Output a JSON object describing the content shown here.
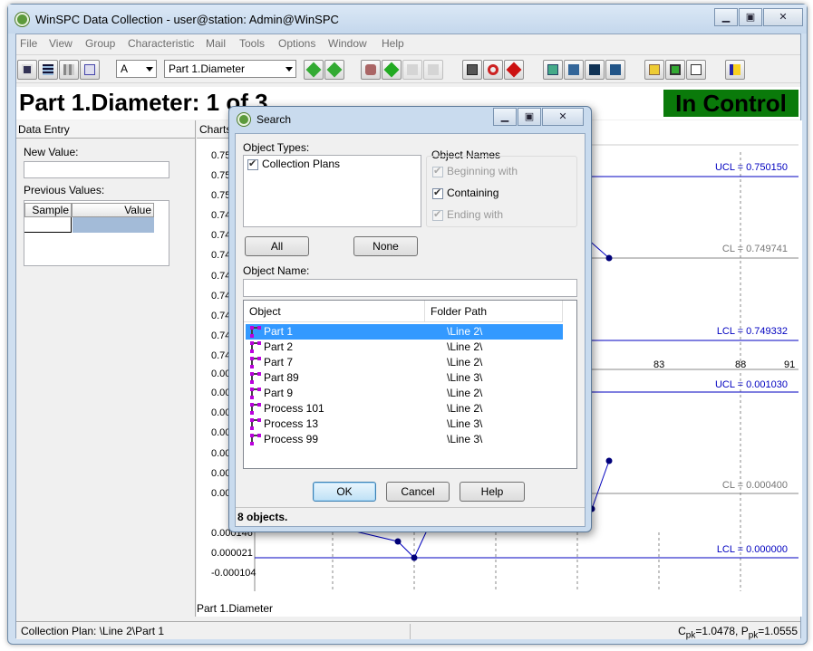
{
  "window": {
    "title": "WinSPC Data Collection - user@station: Admin@WinSPC",
    "minimize": "▁",
    "restore": "▣",
    "close": "✕"
  },
  "menu": [
    "File",
    "View",
    "Group",
    "Characteristic",
    "Mail",
    "Tools",
    "Options",
    "Window",
    "Help"
  ],
  "toolbar": {
    "group_value": "A",
    "characteristic_value": "Part 1.Diameter"
  },
  "header": {
    "title": "Part 1.Diameter:  1 of 3",
    "status": "In Control"
  },
  "data_entry": {
    "header": "Data Entry",
    "new_value_label": "New Value:",
    "previous_values_label": "Previous Values:",
    "col_sample": "Sample",
    "col_value": "Value"
  },
  "charts": {
    "tab_label": "Charts",
    "caption": "Part 1.Diameter",
    "upper_ticks": [
      "0.75",
      "0.75",
      "0.75",
      "0.74",
      "0.74",
      "0.74",
      "0.74",
      "0.74",
      "0.74",
      "0.74",
      "0.74"
    ],
    "lower_ticks": [
      "0.00",
      "0.00",
      "0.00",
      "0.00",
      "0.00",
      "0.00",
      "0.00",
      "0.000146",
      "0.000021",
      "-0.000104"
    ],
    "x_ticks": [
      "83",
      "88",
      "91"
    ],
    "ucl_x": "UCL = 0.750150",
    "cl_x": "CL = 0.749741",
    "lcl_x": "LCL = 0.749332",
    "ucl_r": "UCL = 0.001030",
    "cl_r": "CL = 0.000400",
    "lcl_r": "LCL = 0.000000"
  },
  "statusbar": {
    "left": "Collection Plan: \\Line 2\\Part 1",
    "right_cpk": "C",
    "right_cpk_sub": "pk",
    "right_cpk_val": "=1.0478, P",
    "right_ppk_sub": "pk",
    "right_ppk_val": "=1.0555"
  },
  "search_dialog": {
    "title": "Search",
    "object_types_label": "Object Types:",
    "object_types": [
      {
        "label": "Collection Plans",
        "checked": true
      }
    ],
    "object_names_label": "Object Names",
    "name_options": [
      {
        "label": "Beginning with",
        "checked": true,
        "enabled": false
      },
      {
        "label": "Containing",
        "checked": true,
        "enabled": true
      },
      {
        "label": "Ending with",
        "checked": true,
        "enabled": false
      }
    ],
    "all_button": "All",
    "none_button": "None",
    "object_name_label": "Object Name:",
    "object_name_value": "",
    "col_object": "Object",
    "col_folder": "Folder Path",
    "rows": [
      {
        "object": "Part 1",
        "folder": "\\Line 2\\"
      },
      {
        "object": "Part 2",
        "folder": "\\Line 2\\"
      },
      {
        "object": "Part 7",
        "folder": "\\Line 2\\"
      },
      {
        "object": "Part 89",
        "folder": "\\Line 3\\"
      },
      {
        "object": "Part 9",
        "folder": "\\Line 2\\"
      },
      {
        "object": "Process 101",
        "folder": "\\Line 2\\"
      },
      {
        "object": "Process 13",
        "folder": "\\Line 3\\"
      },
      {
        "object": "Process 99",
        "folder": "\\Line 3\\"
      }
    ],
    "selected_row": 0,
    "ok_button": "OK",
    "cancel_button": "Cancel",
    "help_button": "Help",
    "status": "8 objects."
  },
  "colors": {
    "control_badge": "#0a7a0a",
    "limit_line": "#0000c0",
    "selection": "#3399ff",
    "point": "#00007a"
  }
}
